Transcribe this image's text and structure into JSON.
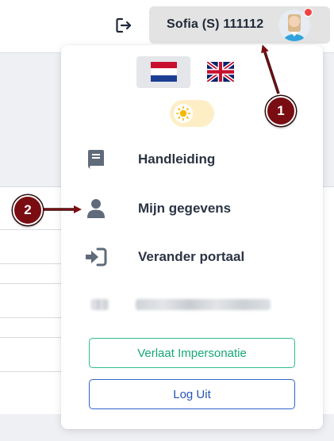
{
  "header": {
    "user_name": "Sofia (S) 111112",
    "logout_icon": "logout-icon",
    "avatar_icon": "avatar-icon",
    "notification_color": "#ef4444"
  },
  "dropdown": {
    "languages": [
      {
        "name": "nl",
        "icon": "flag-netherlands-icon",
        "selected": true
      },
      {
        "name": "en",
        "icon": "flag-uk-icon",
        "selected": false
      }
    ],
    "theme_toggle": {
      "icon": "sun-icon",
      "mode": "light"
    },
    "menu_items": [
      {
        "label": "Handleiding",
        "icon": "book-icon"
      },
      {
        "label": "Mijn gegevens",
        "icon": "user-icon"
      },
      {
        "label": "Verander portaal",
        "icon": "sign-in-icon"
      }
    ],
    "buttons": {
      "impersonation": "Verlaat Impersonatie",
      "logout": "Log Uit"
    },
    "colors": {
      "impersonation": "#16a874",
      "logout": "#2553b4"
    }
  },
  "annotations": {
    "marker_1": "1",
    "marker_2": "2",
    "marker_color": "#7a0d12"
  }
}
